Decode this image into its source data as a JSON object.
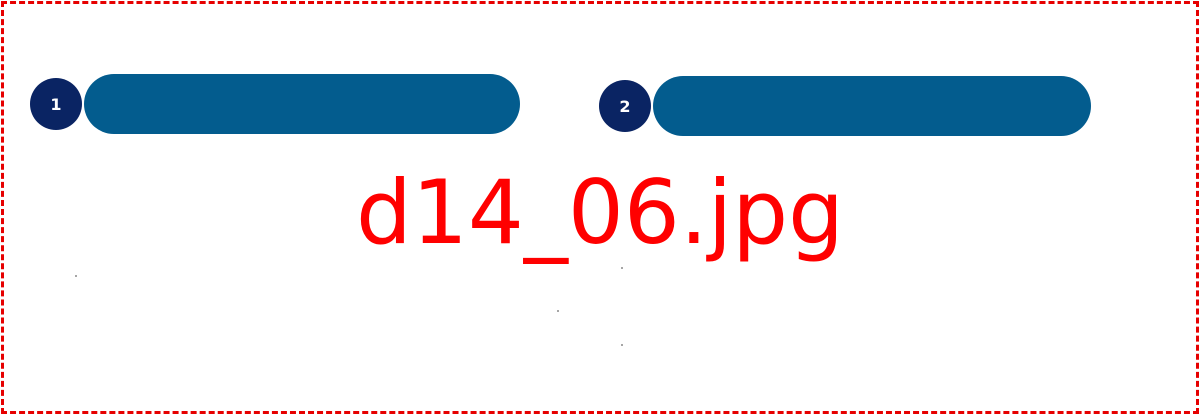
{
  "steps": [
    {
      "number": "1",
      "label": ""
    },
    {
      "number": "2",
      "label": ""
    }
  ],
  "placeholder": {
    "filename": "d14_06.jpg"
  },
  "colors": {
    "frame_border": "#e60000",
    "filename_text": "#ff0000",
    "step_circle": "#0a2463",
    "step_bar": "#035c8e"
  }
}
